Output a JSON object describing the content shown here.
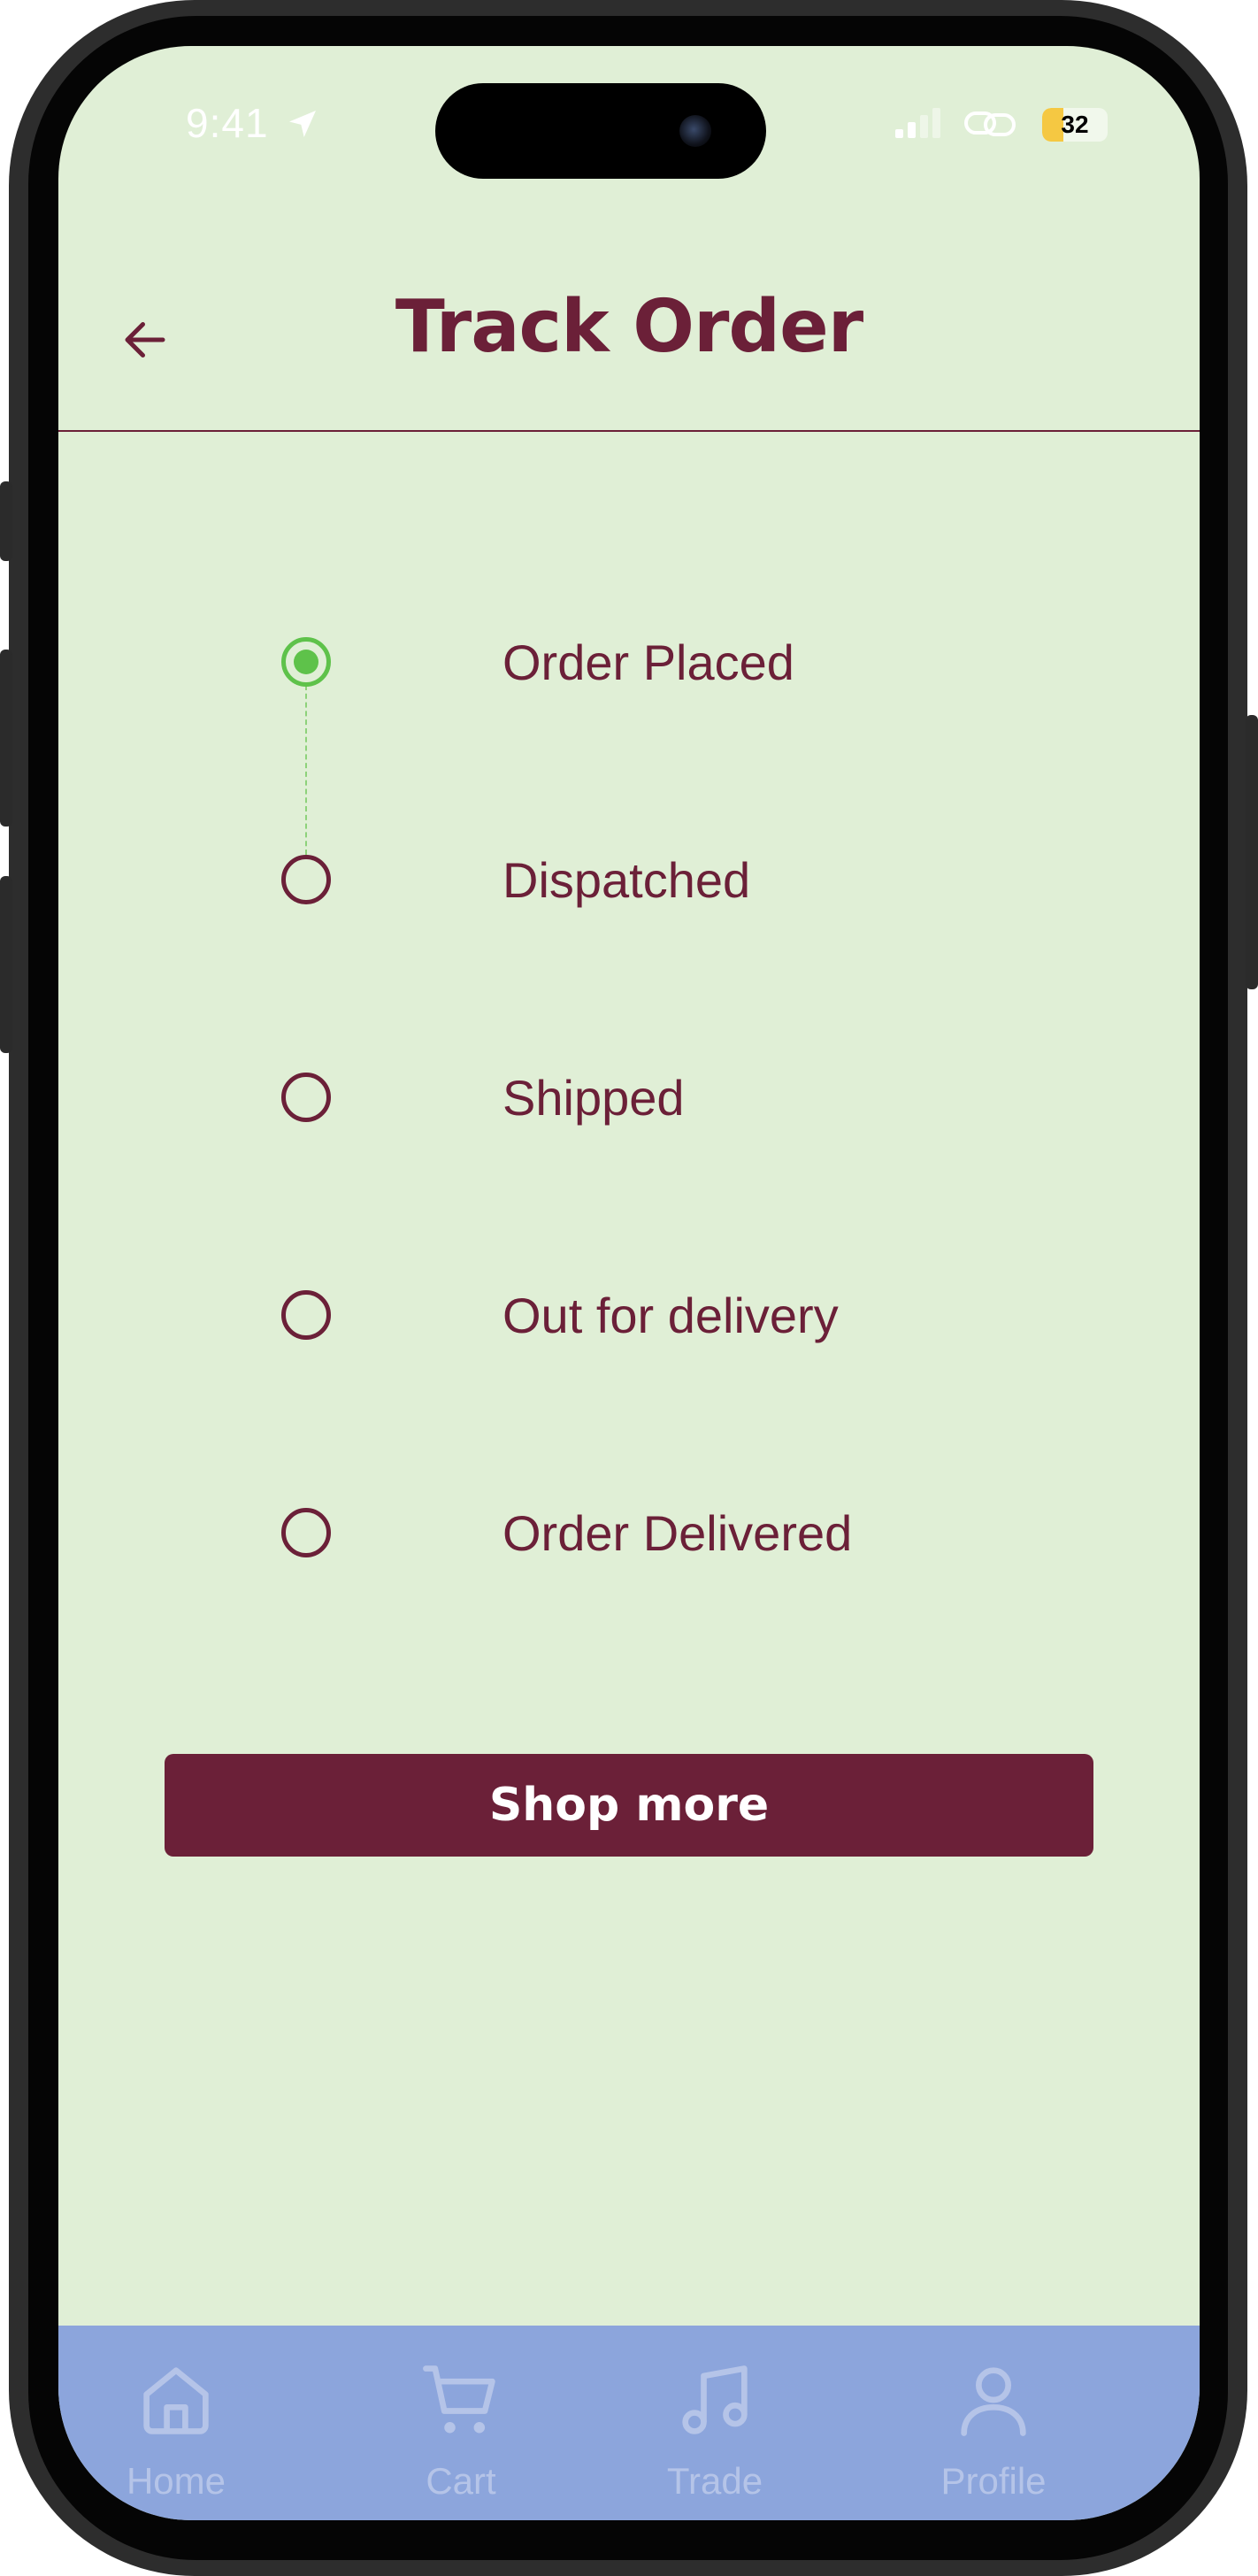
{
  "status_bar": {
    "time": "9:41",
    "battery": "32",
    "battery_level": 0.32
  },
  "header": {
    "title": "Track Order",
    "back_icon": "arrow-left-icon"
  },
  "tracking": {
    "steps": [
      {
        "label": "Order Placed",
        "completed": true
      },
      {
        "label": "Dispatched",
        "completed": false
      },
      {
        "label": "Shipped",
        "completed": false
      },
      {
        "label": "Out for delivery",
        "completed": false
      },
      {
        "label": "Order Delivered",
        "completed": false
      }
    ]
  },
  "actions": {
    "shop_more_label": "Shop more"
  },
  "bottom_nav": {
    "items": [
      {
        "label": "Home",
        "icon": "home-icon"
      },
      {
        "label": "Cart",
        "icon": "cart-icon"
      },
      {
        "label": "Trade",
        "icon": "music-note-icon"
      },
      {
        "label": "Profile",
        "icon": "user-icon"
      }
    ]
  },
  "colors": {
    "background": "#e0efd6",
    "primary": "#6b2038",
    "active_step": "#5ec24a",
    "nav_background": "#8ca5dc",
    "nav_foreground": "#b5c4e8"
  }
}
